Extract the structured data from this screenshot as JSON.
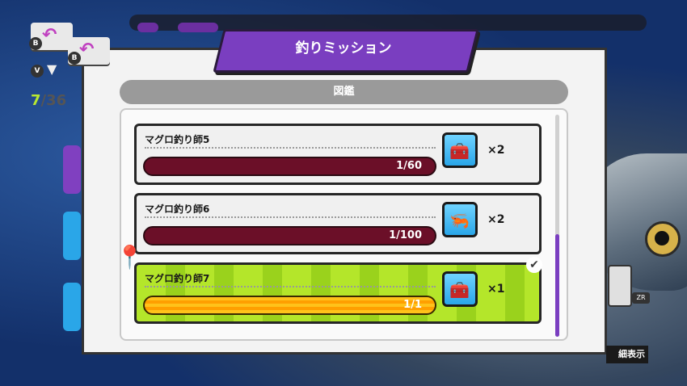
{
  "title": "釣りミッション",
  "section_label": "図鑑",
  "counter": {
    "current": "7",
    "rest": "/36"
  },
  "buttons": {
    "back_badge": "B",
    "filter_badge": "V",
    "zoom_badge": "ZR",
    "detail_label": "細表示"
  },
  "missions": [
    {
      "name": "マグロ釣り師5",
      "progress_text": "1/60",
      "reward_icon": "tackle-box-icon",
      "qty": "×2",
      "completed": false
    },
    {
      "name": "マグロ釣り師6",
      "progress_text": "1/100",
      "reward_icon": "red-lure-icon",
      "qty": "×2",
      "completed": false
    },
    {
      "name": "マグロ釣り師7",
      "progress_text": "1/1",
      "reward_icon": "tackle-box-icon",
      "qty": "×1",
      "completed": true
    }
  ],
  "colors": {
    "accent": "#7a3ec0",
    "done": "#b4e62a",
    "bar": "#6b0f28",
    "gold": "#ffb000"
  }
}
